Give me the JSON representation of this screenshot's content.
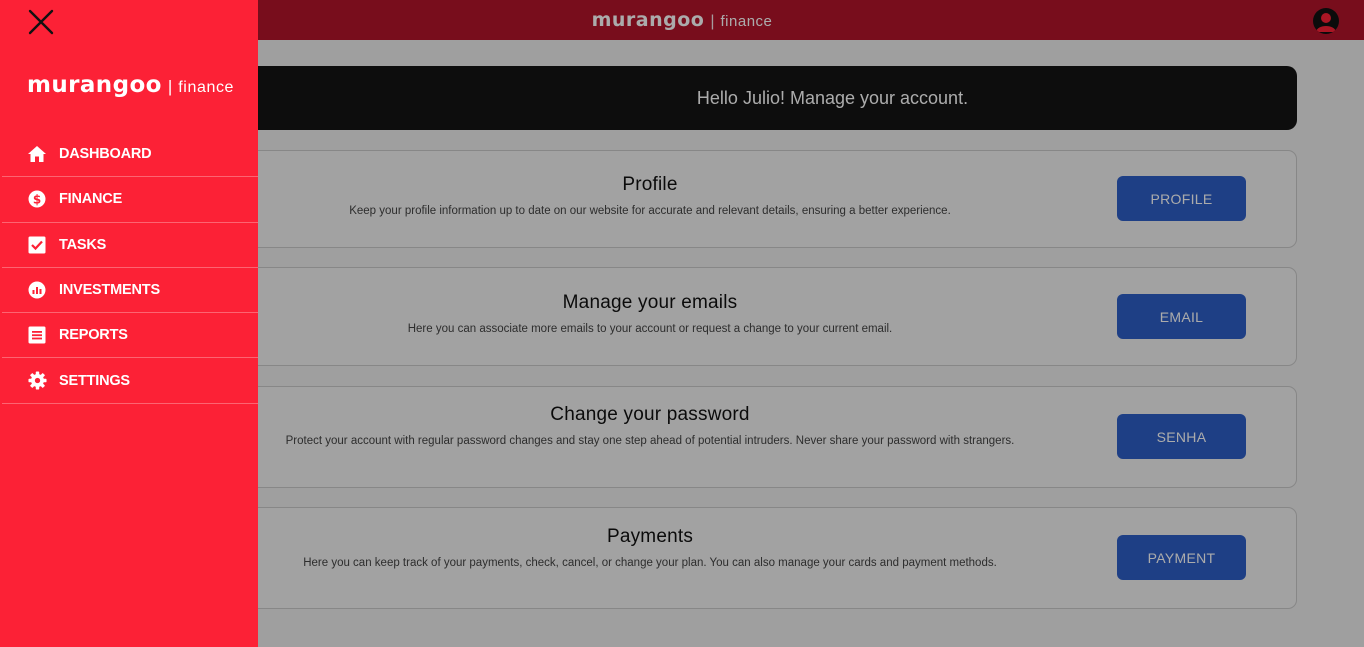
{
  "header": {
    "brand_main": "murangoo",
    "brand_sep": "|",
    "brand_sub": "finance",
    "avatar_icon": "user-icon"
  },
  "drawer": {
    "close_icon": "close-icon",
    "brand_main": "murangoo",
    "brand_sep": "|",
    "brand_sub": "finance",
    "items": [
      {
        "label": "DASHBOARD",
        "icon": "home-icon"
      },
      {
        "label": "FINANCE",
        "icon": "dollar-icon"
      },
      {
        "label": "TASKS",
        "icon": "checkbox-icon"
      },
      {
        "label": "INVESTMENTS",
        "icon": "chart-icon"
      },
      {
        "label": "REPORTS",
        "icon": "list-icon"
      },
      {
        "label": "SETTINGS",
        "icon": "gear-icon"
      }
    ]
  },
  "main": {
    "greeting": "Hello Julio! Manage your account.",
    "cards": [
      {
        "title": "Profile",
        "description": "Keep your profile information up to date on our website for accurate and relevant details, ensuring a better experience.",
        "button": "PROFILE"
      },
      {
        "title": "Manage your emails",
        "description": "Here you can associate more emails to your account or request a change to your current email.",
        "button": "EMAIL"
      },
      {
        "title": "Change your password",
        "description": "Protect your account with regular password changes and stay one step ahead of potential intruders. Never share your password with strangers.",
        "button": "SENHA"
      },
      {
        "title": "Payments",
        "description": "Here you can keep track of your payments, check, cancel, or change your plan. You can also manage your cards and payment methods.",
        "button": "PAYMENT"
      }
    ]
  },
  "colors": {
    "drawer_bg": "#fc2136",
    "header_bg": "#b3142b",
    "button_bg": "#2e5fc6",
    "hero_bg": "#141414"
  }
}
